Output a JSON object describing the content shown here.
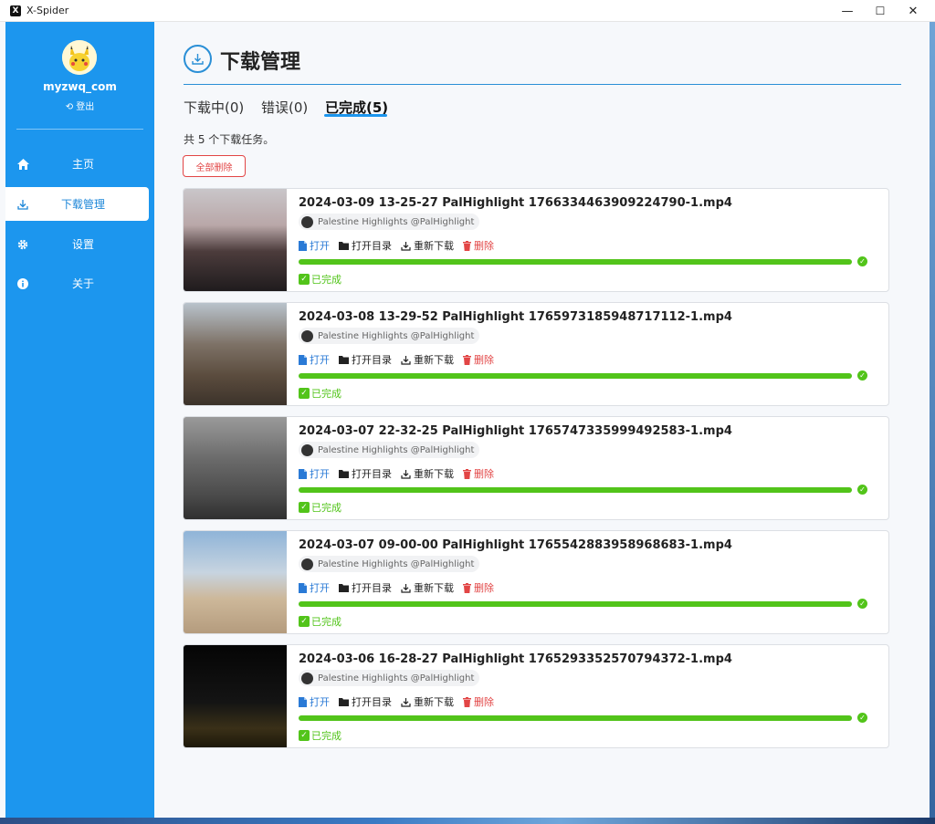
{
  "window": {
    "title": "X-Spider",
    "minimize": "—",
    "maximize": "☐",
    "close": "✕"
  },
  "sidebar": {
    "username": "myzwq_com",
    "logout": "登出",
    "items": [
      {
        "label": "主页",
        "icon": "home-icon"
      },
      {
        "label": "下载管理",
        "icon": "download-icon"
      },
      {
        "label": "设置",
        "icon": "gear-icon"
      },
      {
        "label": "关于",
        "icon": "info-icon"
      }
    ],
    "active_index": 1
  },
  "header": {
    "title": "下载管理"
  },
  "tabs": [
    {
      "label": "下载中(0)"
    },
    {
      "label": "错误(0)"
    },
    {
      "label": "已完成(5)"
    }
  ],
  "summary": {
    "total_text": "共 5 个下载任务。",
    "delete_all": "全部删除"
  },
  "action_labels": {
    "open": "打开",
    "open_dir": "打开目录",
    "redownload": "重新下载",
    "delete": "删除"
  },
  "status_done": "已完成",
  "downloads": [
    {
      "file": "2024-03-09 13-25-27 PalHighlight 1766334463909224790-1.mp4",
      "author": "Palestine Highlights @PalHighlight",
      "progress": 100
    },
    {
      "file": "2024-03-08 13-29-52 PalHighlight 1765973185948717112-1.mp4",
      "author": "Palestine Highlights @PalHighlight",
      "progress": 100
    },
    {
      "file": "2024-03-07 22-32-25 PalHighlight 1765747335999492583-1.mp4",
      "author": "Palestine Highlights @PalHighlight",
      "progress": 100
    },
    {
      "file": "2024-03-07 09-00-00 PalHighlight 1765542883958968683-1.mp4",
      "author": "Palestine Highlights @PalHighlight",
      "progress": 100
    },
    {
      "file": "2024-03-06 16-28-27 PalHighlight 1765293352570794372-1.mp4",
      "author": "Palestine Highlights @PalHighlight",
      "progress": 100
    }
  ],
  "colors": {
    "sidebar": "#1c96ee",
    "accent": "#2a8fd6",
    "success": "#52c41a",
    "danger": "#e24545"
  }
}
